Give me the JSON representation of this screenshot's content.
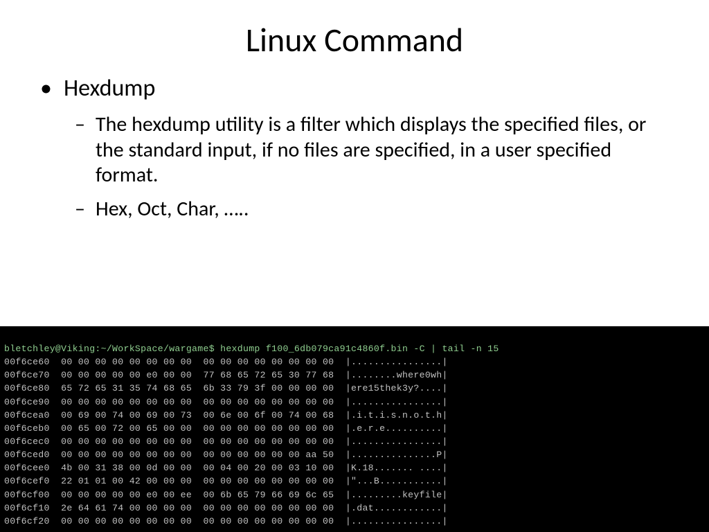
{
  "title": "Linux Command",
  "bullet1": "Hexdump",
  "bullet2a": "The hexdump utility is a filter which displays the specified files, or the standard input, if no files are specified, in a user specified format.",
  "bullet2b": "Hex, Oct, Char, …..",
  "prompt": "bletchley@Viking:~/WorkSpace/wargame$ hexdump f100_6db079ca91c4860f.bin -C | tail -n 15",
  "hex_rows": [
    {
      "offset": "00f6ce60",
      "bytes": "00 00 00 00 00 00 00 00  00 00 00 00 00 00 00 00",
      "ascii": "|................|"
    },
    {
      "offset": "00f6ce70",
      "bytes": "00 00 00 00 00 e0 00 00  77 68 65 72 65 30 77 68",
      "ascii": "|........where0wh|"
    },
    {
      "offset": "00f6ce80",
      "bytes": "65 72 65 31 35 74 68 65  6b 33 79 3f 00 00 00 00",
      "ascii": "|ere15thek3y?....|"
    },
    {
      "offset": "00f6ce90",
      "bytes": "00 00 00 00 00 00 00 00  00 00 00 00 00 00 00 00",
      "ascii": "|................|"
    },
    {
      "offset": "00f6cea0",
      "bytes": "00 69 00 74 00 69 00 73  00 6e 00 6f 00 74 00 68",
      "ascii": "|.i.t.i.s.n.o.t.h|"
    },
    {
      "offset": "00f6ceb0",
      "bytes": "00 65 00 72 00 65 00 00  00 00 00 00 00 00 00 00",
      "ascii": "|.e.r.e..........|"
    },
    {
      "offset": "00f6cec0",
      "bytes": "00 00 00 00 00 00 00 00  00 00 00 00 00 00 00 00",
      "ascii": "|................|"
    },
    {
      "offset": "00f6ced0",
      "bytes": "00 00 00 00 00 00 00 00  00 00 00 00 00 00 aa 50",
      "ascii": "|...............P|"
    },
    {
      "offset": "00f6cee0",
      "bytes": "4b 00 31 38 00 0d 00 00  00 04 00 20 00 03 10 00",
      "ascii": "|K.18....... ....|"
    },
    {
      "offset": "00f6cef0",
      "bytes": "22 01 01 00 42 00 00 00  00 00 00 00 00 00 00 00",
      "ascii": "|\"...B...........|"
    },
    {
      "offset": "00f6cf00",
      "bytes": "00 00 00 00 00 e0 00 ee  00 6b 65 79 66 69 6c 65",
      "ascii": "|.........keyfile|"
    },
    {
      "offset": "00f6cf10",
      "bytes": "2e 64 61 74 00 00 00 00  00 00 00 00 00 00 00 00",
      "ascii": "|.dat............|"
    },
    {
      "offset": "00f6cf20",
      "bytes": "00 00 00 00 00 00 00 00  00 00 00 00 00 00 00 00",
      "ascii": "|................|"
    }
  ]
}
